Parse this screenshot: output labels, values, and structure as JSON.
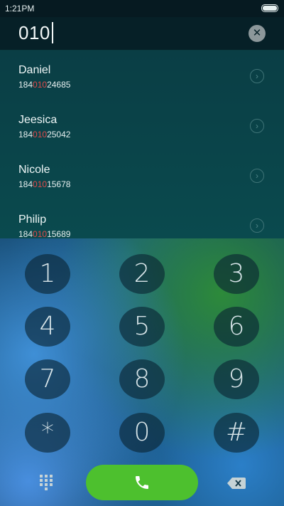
{
  "status_bar": {
    "time": "1:21PM"
  },
  "dialer": {
    "input_value": "010"
  },
  "contacts": [
    {
      "name": "Daniel",
      "number_prefix": "184",
      "number_match": "010",
      "number_suffix": "24685"
    },
    {
      "name": "Jeesica",
      "number_prefix": "184",
      "number_match": "010",
      "number_suffix": "25042"
    },
    {
      "name": "Nicole",
      "number_prefix": "184",
      "number_match": "010",
      "number_suffix": "15678"
    },
    {
      "name": "Philip",
      "number_prefix": "184",
      "number_match": "010",
      "number_suffix": "15689"
    }
  ],
  "keypad": {
    "keys": [
      "1",
      "2",
      "3",
      "4",
      "5",
      "6",
      "7",
      "8",
      "9",
      "*",
      "0",
      "#"
    ]
  },
  "icons": {
    "clear": "close-circle-icon",
    "contact_detail": "chevron-right-circle-icon",
    "dialpad": "dialpad-grid-icon",
    "call": "phone-icon",
    "backspace": "backspace-icon"
  },
  "colors": {
    "match_highlight": "#e24a4a",
    "call_button": "#4dc02e",
    "header_background": "#062027"
  }
}
